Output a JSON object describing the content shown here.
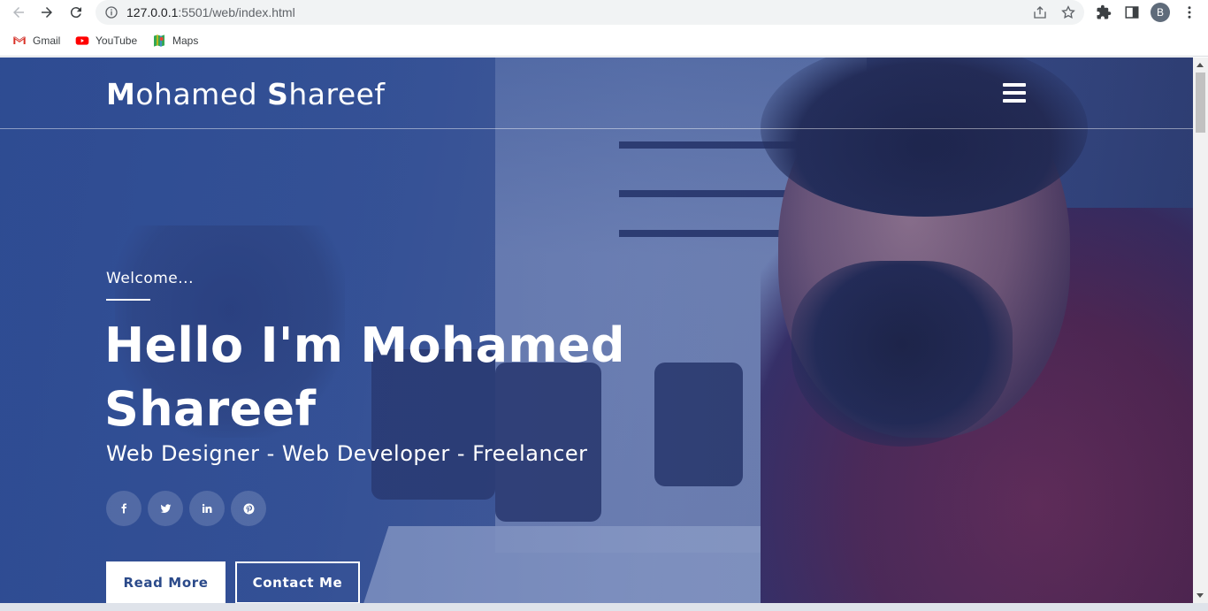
{
  "browser": {
    "url_host": "127.0.0.1",
    "url_path": ":5501/web/index.html",
    "profile_initial": "B",
    "bookmarks": [
      {
        "label": "Gmail",
        "icon": "gmail-icon"
      },
      {
        "label": "YouTube",
        "icon": "youtube-icon"
      },
      {
        "label": "Maps",
        "icon": "maps-icon"
      }
    ]
  },
  "site": {
    "logo_first_initial": "M",
    "logo_first_rest": "ohamed ",
    "logo_last_initial": "S",
    "logo_last_rest": "hareef",
    "menu_icon": "hamburger-icon"
  },
  "hero": {
    "welcome": "Welcome...",
    "title": "Hello I'm Mohamed Shareef",
    "subtitle": "Web Designer - Web Developer - Freelancer",
    "socials": [
      {
        "name": "facebook",
        "glyph": "f"
      },
      {
        "name": "twitter",
        "glyph": "t"
      },
      {
        "name": "linkedin",
        "glyph": "in"
      },
      {
        "name": "pinterest",
        "glyph": "p"
      }
    ],
    "read_more": "Read More",
    "contact_me": "Contact Me"
  },
  "colors": {
    "overlay_blue": "#2f4f9a",
    "button_text": "#2b4a8a"
  }
}
